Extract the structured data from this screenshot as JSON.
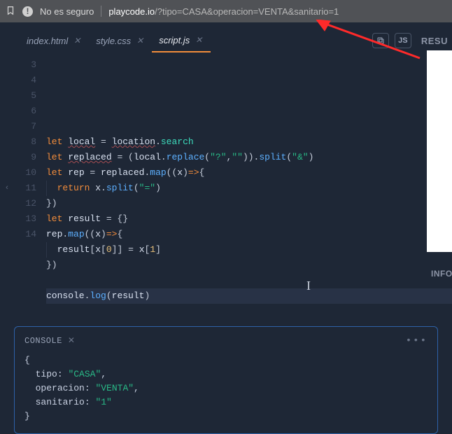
{
  "browser": {
    "not_secure": "No es seguro",
    "host": "playcode.io",
    "path": "/?tipo=CASA&operacion=VENTA&sanitario=1"
  },
  "tabs": [
    {
      "label": "index.html",
      "active": false
    },
    {
      "label": "style.css",
      "active": false
    },
    {
      "label": "script.js",
      "active": true
    }
  ],
  "toolbar": {
    "js_label": "JS"
  },
  "right_labels": {
    "result": "RESU",
    "info": "INFO"
  },
  "editor": {
    "first_line_number": 3,
    "lines": [
      {
        "tokens": []
      },
      {
        "tokens": [
          {
            "t": "let ",
            "c": "kw"
          },
          {
            "t": "local",
            "c": "var squig"
          },
          {
            "t": " = ",
            "c": "op"
          },
          {
            "t": "location",
            "c": "var squig"
          },
          {
            "t": ".",
            "c": "pun"
          },
          {
            "t": "search",
            "c": "prop"
          }
        ]
      },
      {
        "tokens": [
          {
            "t": "let ",
            "c": "kw"
          },
          {
            "t": "replaced",
            "c": "var squig"
          },
          {
            "t": " = (",
            "c": "pun"
          },
          {
            "t": "local",
            "c": "var"
          },
          {
            "t": ".",
            "c": "pun"
          },
          {
            "t": "replace",
            "c": "fn"
          },
          {
            "t": "(",
            "c": "pun"
          },
          {
            "t": "\"?\"",
            "c": "str"
          },
          {
            "t": ",",
            "c": "pun"
          },
          {
            "t": "\"\"",
            "c": "str"
          },
          {
            "t": ")).",
            "c": "pun"
          },
          {
            "t": "split",
            "c": "fn"
          },
          {
            "t": "(",
            "c": "pun"
          },
          {
            "t": "\"&\"",
            "c": "str"
          },
          {
            "t": ")",
            "c": "pun"
          }
        ]
      },
      {
        "tokens": [
          {
            "t": "let ",
            "c": "kw"
          },
          {
            "t": "rep",
            "c": "var"
          },
          {
            "t": " = ",
            "c": "op"
          },
          {
            "t": "replaced",
            "c": "var"
          },
          {
            "t": ".",
            "c": "pun"
          },
          {
            "t": "map",
            "c": "fn"
          },
          {
            "t": "((",
            "c": "pun"
          },
          {
            "t": "x",
            "c": "var"
          },
          {
            "t": ")",
            "c": "pun"
          },
          {
            "t": "=>",
            "c": "kw"
          },
          {
            "t": "{",
            "c": "pun"
          }
        ]
      },
      {
        "indent": 1,
        "tokens": [
          {
            "t": "return ",
            "c": "kw"
          },
          {
            "t": "x",
            "c": "var"
          },
          {
            "t": ".",
            "c": "pun"
          },
          {
            "t": "split",
            "c": "fn"
          },
          {
            "t": "(",
            "c": "pun"
          },
          {
            "t": "\"=\"",
            "c": "str"
          },
          {
            "t": ")",
            "c": "pun"
          }
        ]
      },
      {
        "tokens": [
          {
            "t": "})",
            "c": "pun"
          }
        ]
      },
      {
        "tokens": [
          {
            "t": "let ",
            "c": "kw"
          },
          {
            "t": "result",
            "c": "var"
          },
          {
            "t": " = {}",
            "c": "pun"
          }
        ]
      },
      {
        "tokens": [
          {
            "t": "rep",
            "c": "var"
          },
          {
            "t": ".",
            "c": "pun"
          },
          {
            "t": "map",
            "c": "fn"
          },
          {
            "t": "((",
            "c": "pun"
          },
          {
            "t": "x",
            "c": "var"
          },
          {
            "t": ")",
            "c": "pun"
          },
          {
            "t": "=>",
            "c": "kw"
          },
          {
            "t": "{",
            "c": "pun"
          }
        ]
      },
      {
        "indent": 1,
        "tokens": [
          {
            "t": "result",
            "c": "var"
          },
          {
            "t": "[",
            "c": "pun"
          },
          {
            "t": "x",
            "c": "var"
          },
          {
            "t": "[",
            "c": "pun"
          },
          {
            "t": "0",
            "c": "num"
          },
          {
            "t": "]] = ",
            "c": "pun"
          },
          {
            "t": "x",
            "c": "var"
          },
          {
            "t": "[",
            "c": "pun"
          },
          {
            "t": "1",
            "c": "num"
          },
          {
            "t": "]",
            "c": "pun"
          }
        ]
      },
      {
        "tokens": [
          {
            "t": "})",
            "c": "pun"
          }
        ]
      },
      {
        "tokens": []
      },
      {
        "highlight": true,
        "tokens": [
          {
            "t": "console",
            "c": "var"
          },
          {
            "t": ".",
            "c": "pun"
          },
          {
            "t": "log",
            "c": "fn"
          },
          {
            "t": "(",
            "c": "pun"
          },
          {
            "t": "result",
            "c": "var"
          },
          {
            "t": ")",
            "c": "pun"
          }
        ]
      }
    ]
  },
  "console": {
    "title": "CONSOLE",
    "output": [
      {
        "t": "{",
        "c": "pun"
      },
      {
        "indent": 1,
        "key": "tipo",
        "val": "\"CASA\"",
        "comma": true
      },
      {
        "indent": 1,
        "key": "operacion",
        "val": "\"VENTA\"",
        "comma": true
      },
      {
        "indent": 1,
        "key": "sanitario",
        "val": "\"1\"",
        "comma": false
      },
      {
        "t": "}",
        "c": "pun"
      }
    ]
  }
}
